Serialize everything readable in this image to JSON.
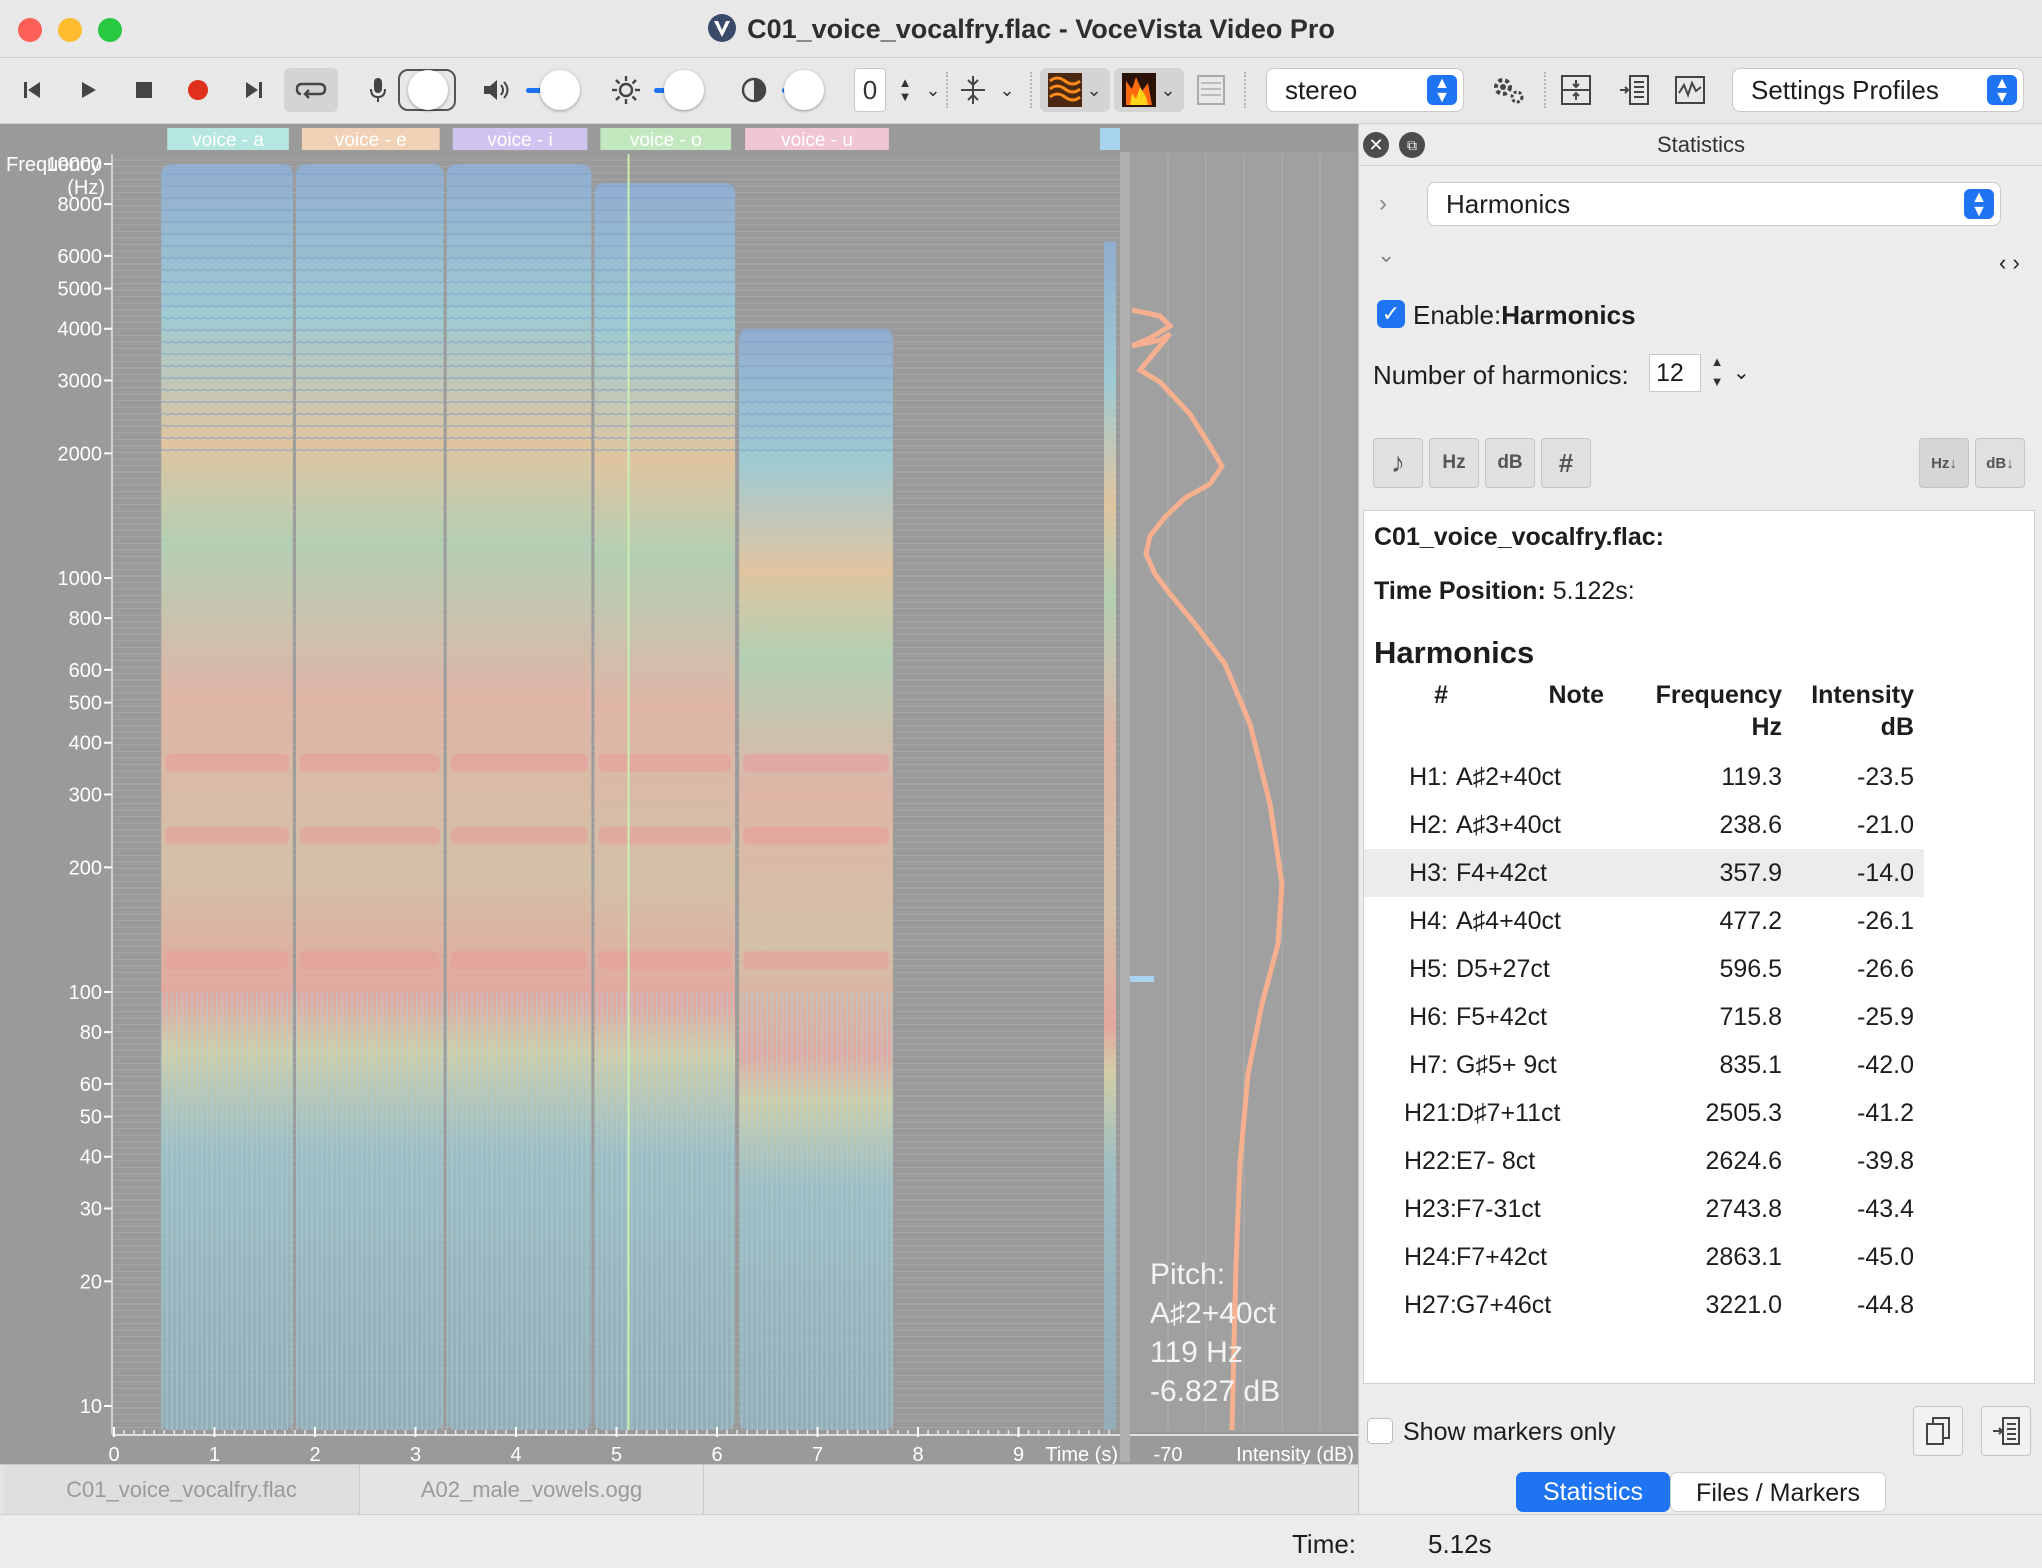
{
  "window": {
    "title": "C01_voice_vocalfry.flac - VoceVista Video Pro"
  },
  "toolbar": {
    "gain_value": "0",
    "channel_select": "stereo",
    "settings_profiles": "Settings Profiles"
  },
  "spectrogram": {
    "freq_axis_title_1": "Frequency",
    "freq_axis_title_2": "(Hz)",
    "freq_ticks": [
      "10000",
      "8000",
      "6000",
      "5000",
      "4000",
      "3000",
      "2000",
      "1000",
      "800",
      "600",
      "500",
      "400",
      "300",
      "200",
      "100",
      "80",
      "60",
      "50",
      "40",
      "30",
      "20",
      "10"
    ],
    "time_ticks": [
      "0",
      "1",
      "2",
      "3",
      "4",
      "5",
      "6",
      "7",
      "8",
      "9"
    ],
    "time_label": "Time (s)",
    "intensity_tick": "-70",
    "intensity_label": "Intensity (dB)",
    "markers": [
      {
        "label": "voice - a",
        "color": "#b5e6e0"
      },
      {
        "label": "voice - e",
        "color": "#f1d2b6"
      },
      {
        "label": "voice - i",
        "color": "#cfc3ef"
      },
      {
        "label": "voice - o",
        "color": "#c3e8bf"
      },
      {
        "label": "voice - u",
        "color": "#f0c6d6"
      }
    ],
    "cursor_time": 5.12,
    "pitch_label": "Pitch:",
    "pitch_note": "A♯2+40ct",
    "pitch_hz": "119 Hz",
    "pitch_db": "-6.827 dB"
  },
  "file_tabs": [
    "C01_voice_vocalfry.flac",
    "A02_male_vowels.ogg"
  ],
  "status": {
    "time_label": "Time:",
    "time_value": "5.12s"
  },
  "panel": {
    "title": "Statistics",
    "view_select": "Harmonics",
    "enable_label": "Enable:",
    "enable_value": "Harmonics",
    "num_harmonics_label": "Number of harmonics:",
    "num_harmonics_value": "12",
    "unit_buttons": [
      "♪",
      "Hz",
      "dB",
      "#"
    ],
    "sort_buttons": [
      "Hz↓",
      "dB↓"
    ],
    "report_file": "C01_voice_vocalfry.flac:",
    "time_position_label": "Time Position:",
    "time_position_value": "5.122s:",
    "section_title": "Harmonics",
    "columns": {
      "num": "#",
      "note": "Note",
      "frequency": "Frequency",
      "frequency_unit": "Hz",
      "intensity": "Intensity",
      "intensity_unit": "dB"
    },
    "rows": [
      {
        "h": "H1:",
        "note": "A♯2+40ct",
        "freq": "119.3",
        "db": "-23.5"
      },
      {
        "h": "H2:",
        "note": "A♯3+40ct",
        "freq": "238.6",
        "db": "-21.0"
      },
      {
        "h": "H3:",
        "note": "F4+42ct",
        "freq": "357.9",
        "db": "-14.0"
      },
      {
        "h": "H4:",
        "note": "A♯4+40ct",
        "freq": "477.2",
        "db": "-26.1"
      },
      {
        "h": "H5:",
        "note": "D5+27ct",
        "freq": "596.5",
        "db": "-26.6"
      },
      {
        "h": "H6:",
        "note": "F5+42ct",
        "freq": "715.8",
        "db": "-25.9"
      },
      {
        "h": "H7:",
        "note": "G♯5+ 9ct",
        "freq": "835.1",
        "db": "-42.0"
      },
      {
        "h": "H21:",
        "note": "D♯7+11ct",
        "freq": "2505.3",
        "db": "-41.2"
      },
      {
        "h": "H22:",
        "note": "E7- 8ct",
        "freq": "2624.6",
        "db": "-39.8"
      },
      {
        "h": "H23:",
        "note": "F7-31ct",
        "freq": "2743.8",
        "db": "-43.4"
      },
      {
        "h": "H24:",
        "note": "F7+42ct",
        "freq": "2863.1",
        "db": "-45.0"
      },
      {
        "h": "H27:",
        "note": "G7+46ct",
        "freq": "3221.0",
        "db": "-44.8"
      }
    ],
    "show_markers_only": "Show markers only",
    "bottom_tabs": [
      "Statistics",
      "Files / Markers"
    ]
  },
  "colors": {
    "accent": "#1f74f3",
    "record": "#e0301e",
    "close": "#fe5f57",
    "minimize": "#febc2e",
    "maximize": "#28c840",
    "intensity_curve": "#f7b08f"
  }
}
